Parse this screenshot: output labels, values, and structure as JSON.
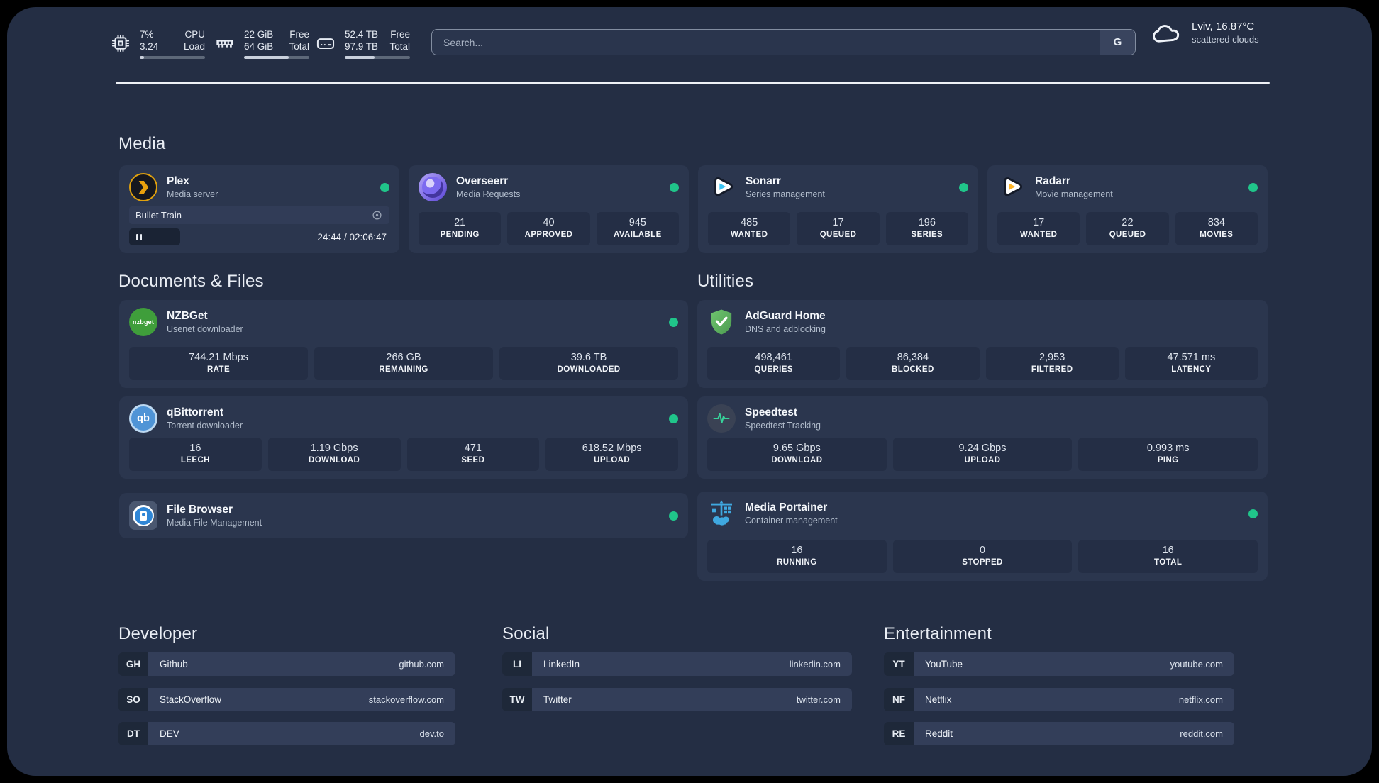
{
  "header": {
    "system_stats": [
      {
        "icon": "cpu-icon",
        "line1": "7%",
        "line2": "3.24",
        "label1": "CPU",
        "label2": "Load",
        "progress": 7
      },
      {
        "icon": "memory-icon",
        "line1": "22 GiB",
        "line2": "64 GiB",
        "label1": "Free",
        "label2": "Total",
        "progress": 69
      },
      {
        "icon": "disk-icon",
        "line1": "52.4 TB",
        "line2": "97.9 TB",
        "label1": "Free",
        "label2": "Total",
        "progress": 46
      }
    ],
    "search": {
      "placeholder": "Search...",
      "engine_button": "G"
    },
    "weather": {
      "location_temp": "Lviv, 16.87°C",
      "condition": "scattered clouds"
    }
  },
  "media": {
    "title": "Media",
    "cards": [
      {
        "title": "Plex",
        "subtitle": "Media server",
        "online": true,
        "now_playing": {
          "track": "Bullet Train",
          "time_display": "24:44 / 02:06:47",
          "progress": 19.5
        }
      },
      {
        "title": "Overseerr",
        "subtitle": "Media Requests",
        "online": true,
        "stats": [
          {
            "value": "21",
            "label": "PENDING"
          },
          {
            "value": "40",
            "label": "APPROVED"
          },
          {
            "value": "945",
            "label": "AVAILABLE"
          }
        ]
      },
      {
        "title": "Sonarr",
        "subtitle": "Series management",
        "online": true,
        "stats": [
          {
            "value": "485",
            "label": "WANTED"
          },
          {
            "value": "17",
            "label": "QUEUED"
          },
          {
            "value": "196",
            "label": "SERIES"
          }
        ]
      },
      {
        "title": "Radarr",
        "subtitle": "Movie management",
        "online": true,
        "stats": [
          {
            "value": "17",
            "label": "WANTED"
          },
          {
            "value": "22",
            "label": "QUEUED"
          },
          {
            "value": "834",
            "label": "MOVIES"
          }
        ]
      }
    ]
  },
  "documents": {
    "title": "Documents & Files",
    "cards": [
      {
        "title": "NZBGet",
        "subtitle": "Usenet downloader",
        "online": true,
        "logo_text": "nzbget",
        "stats": [
          {
            "value": "744.21 Mbps",
            "label": "RATE"
          },
          {
            "value": "266 GB",
            "label": "REMAINING"
          },
          {
            "value": "39.6 TB",
            "label": "DOWNLOADED"
          }
        ]
      },
      {
        "title": "qBittorrent",
        "subtitle": "Torrent downloader",
        "online": true,
        "logo_text": "qb",
        "stats": [
          {
            "value": "16",
            "label": "LEECH"
          },
          {
            "value": "1.19 Gbps",
            "label": "DOWNLOAD"
          },
          {
            "value": "471",
            "label": "SEED"
          },
          {
            "value": "618.52 Mbps",
            "label": "UPLOAD"
          }
        ]
      },
      {
        "title": "File Browser",
        "subtitle": "Media File Management",
        "online": true
      }
    ]
  },
  "utilities": {
    "title": "Utilities",
    "cards": [
      {
        "title": "AdGuard Home",
        "subtitle": "DNS and adblocking",
        "online": false,
        "stats": [
          {
            "value": "498,461",
            "label": "QUERIES"
          },
          {
            "value": "86,384",
            "label": "BLOCKED"
          },
          {
            "value": "2,953",
            "label": "FILTERED"
          },
          {
            "value": "47.571 ms",
            "label": "LATENCY"
          }
        ]
      },
      {
        "title": "Speedtest",
        "subtitle": "Speedtest Tracking",
        "online": false,
        "stats": [
          {
            "value": "9.65 Gbps",
            "label": "DOWNLOAD"
          },
          {
            "value": "9.24 Gbps",
            "label": "UPLOAD"
          },
          {
            "value": "0.993 ms",
            "label": "PING"
          }
        ]
      },
      {
        "title": "Media Portainer",
        "subtitle": "Container management",
        "online": true,
        "stats": [
          {
            "value": "16",
            "label": "RUNNING"
          },
          {
            "value": "0",
            "label": "STOPPED"
          },
          {
            "value": "16",
            "label": "TOTAL"
          }
        ]
      }
    ]
  },
  "links": {
    "developer": {
      "title": "Developer",
      "items": [
        {
          "abbr": "GH",
          "name": "Github",
          "url": "github.com"
        },
        {
          "abbr": "SO",
          "name": "StackOverflow",
          "url": "stackoverflow.com"
        },
        {
          "abbr": "DT",
          "name": "DEV",
          "url": "dev.to"
        }
      ]
    },
    "social": {
      "title": "Social",
      "items": [
        {
          "abbr": "LI",
          "name": "LinkedIn",
          "url": "linkedin.com"
        },
        {
          "abbr": "TW",
          "name": "Twitter",
          "url": "twitter.com"
        }
      ]
    },
    "entertainment": {
      "title": "Entertainment",
      "items": [
        {
          "abbr": "YT",
          "name": "YouTube",
          "url": "youtube.com"
        },
        {
          "abbr": "NF",
          "name": "Netflix",
          "url": "netflix.com"
        },
        {
          "abbr": "RE",
          "name": "Reddit",
          "url": "reddit.com"
        }
      ]
    }
  },
  "colors": {
    "accent_green": "#20C58A",
    "background": "#242E44",
    "card": "#2B364E"
  }
}
